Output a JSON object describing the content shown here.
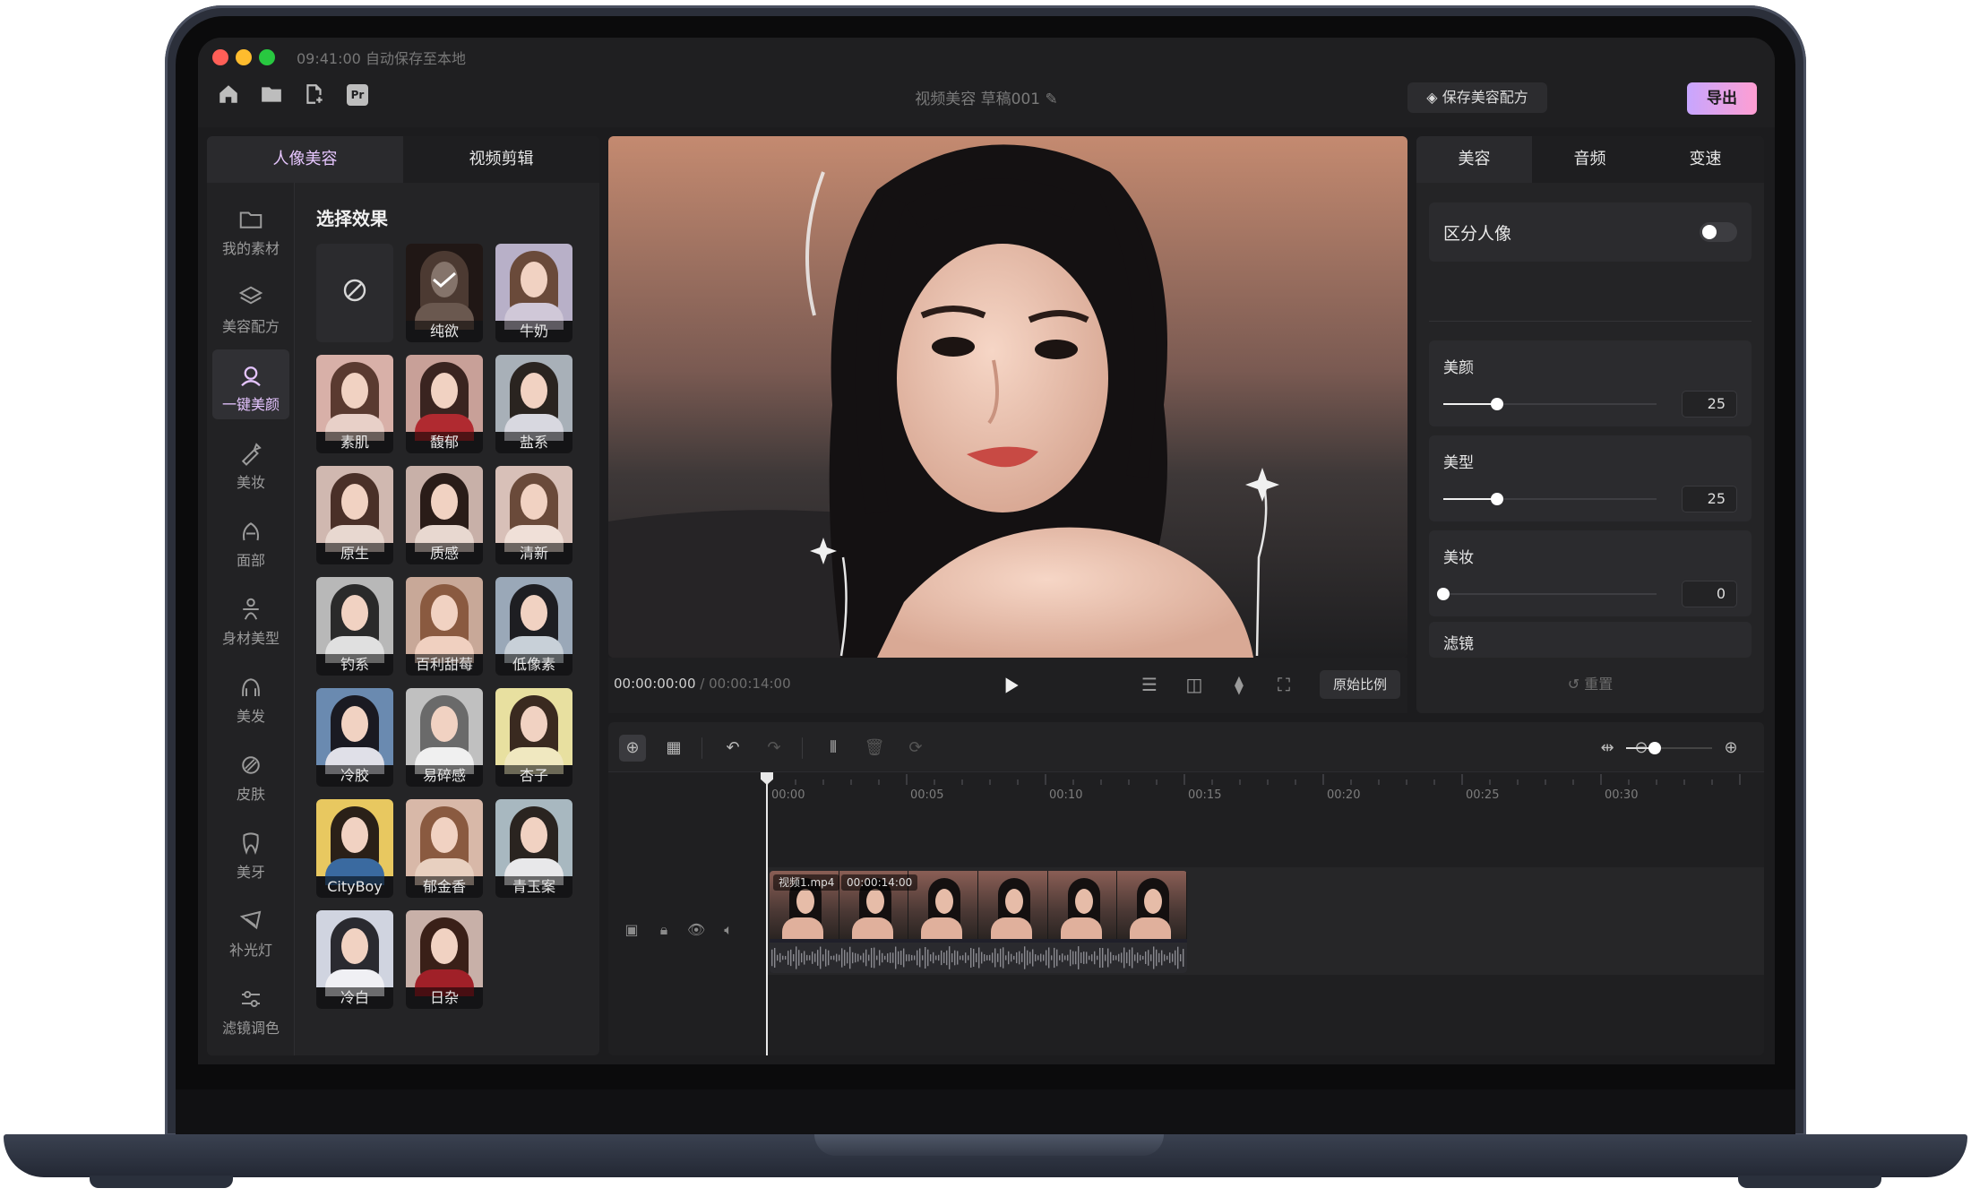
{
  "window": {
    "status": "09:41:00 自动保存至本地",
    "title": "视频美容 草稿001",
    "save_recipe_label": "保存美容配方",
    "export_label": "导出",
    "traffic_colors": [
      "#ff5f57",
      "#febc2e",
      "#28c840"
    ],
    "toolbar_icons": [
      "home-icon",
      "folder-icon",
      "new-file-icon",
      "premiere-icon"
    ],
    "premiere_badge": "Pr"
  },
  "left_panel": {
    "tabs": [
      {
        "label": "人像美容",
        "active": true
      },
      {
        "label": "视频剪辑",
        "active": false
      }
    ],
    "nav": [
      {
        "label": "我的素材",
        "icon": "folder-icon"
      },
      {
        "label": "美容配方",
        "icon": "layers-icon"
      },
      {
        "label": "一键美颜",
        "icon": "face-magic-icon",
        "active": true
      },
      {
        "label": "美妆",
        "icon": "makeup-icon"
      },
      {
        "label": "面部",
        "icon": "face-icon"
      },
      {
        "label": "身材美型",
        "icon": "body-icon"
      },
      {
        "label": "美发",
        "icon": "hair-icon"
      },
      {
        "label": "皮肤",
        "icon": "skin-icon"
      },
      {
        "label": "美牙",
        "icon": "tooth-icon"
      },
      {
        "label": "补光灯",
        "icon": "fill-light-icon"
      },
      {
        "label": "滤镜调色",
        "icon": "sliders-icon"
      }
    ],
    "section_title": "选择效果",
    "effects": [
      {
        "label": "",
        "type": "none"
      },
      {
        "label": "纯欲",
        "selected": true
      },
      {
        "label": "牛奶"
      },
      {
        "label": "素肌"
      },
      {
        "label": "馥郁"
      },
      {
        "label": "盐系"
      },
      {
        "label": "原生"
      },
      {
        "label": "质感"
      },
      {
        "label": "清新"
      },
      {
        "label": "钓系"
      },
      {
        "label": "百利甜莓"
      },
      {
        "label": "低像素"
      },
      {
        "label": "冷胶"
      },
      {
        "label": "易碎感"
      },
      {
        "label": "杏子"
      },
      {
        "label": "CityBoy"
      },
      {
        "label": "郁金香"
      },
      {
        "label": "青玉案"
      },
      {
        "label": "冷白"
      },
      {
        "label": "日杂"
      }
    ]
  },
  "preview": {
    "current_time": "00:00:00:00",
    "total_time": "00:00:14:00",
    "ratio_label": "原始比例",
    "controls": [
      "list-icon",
      "compare-icon",
      "adjust-icon",
      "fullscreen-icon"
    ]
  },
  "right_panel": {
    "tabs": [
      {
        "label": "美容",
        "active": true
      },
      {
        "label": "音频",
        "active": false
      },
      {
        "label": "变速",
        "active": false
      }
    ],
    "distinguish_label": "区分人像",
    "distinguish_on": false,
    "sliders": [
      {
        "label": "美颜",
        "value": "25",
        "fraction": 0.25
      },
      {
        "label": "美型",
        "value": "25",
        "fraction": 0.25
      },
      {
        "label": "美妆",
        "value": "0",
        "fraction": 0
      }
    ],
    "filter_label": "滤镜",
    "reset_label": "重置"
  },
  "timeline": {
    "ticks": [
      "00:00",
      "00:05",
      "00:10",
      "00:15",
      "00:20",
      "00:25",
      "00:30"
    ],
    "clip_name": "视频1.mp4",
    "clip_duration": "00:00:14:00",
    "zoom_fraction": 0.33
  }
}
